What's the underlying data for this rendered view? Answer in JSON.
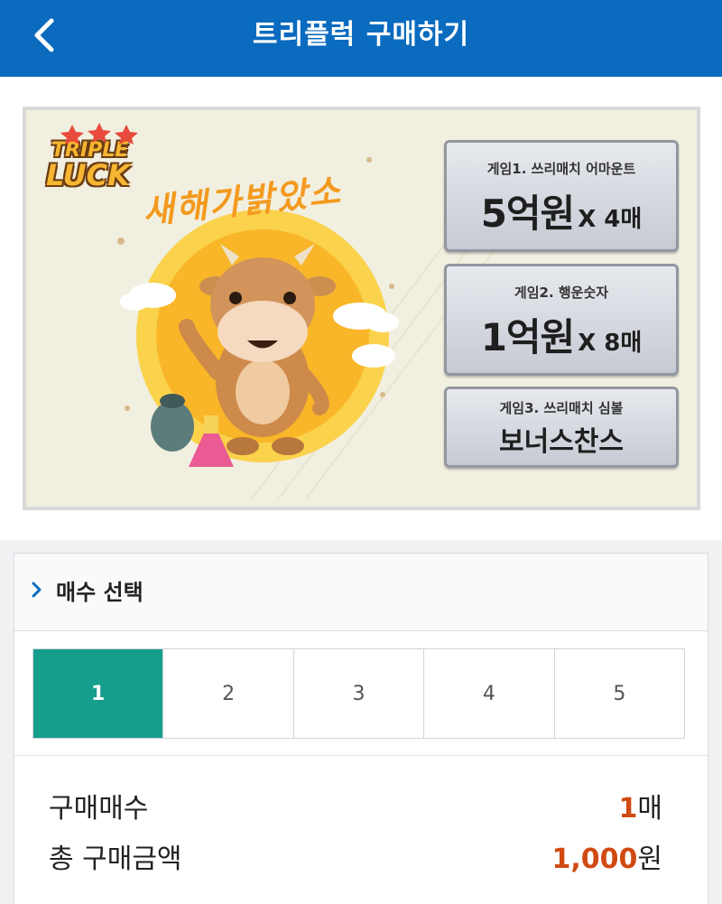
{
  "header": {
    "title": "트리플럭 구매하기",
    "back_icon": "chevron-left-icon"
  },
  "banner": {
    "logo_line1": "TRIPLE",
    "logo_line2": "LUCK",
    "slogan": "새해가밝았소",
    "games": [
      {
        "label": "게임1. 쓰리매치 어마운트",
        "amount": "5억원",
        "count": "X 4매"
      },
      {
        "label": "게임2. 행운숫자",
        "amount": "1억원",
        "count": "X 8매"
      },
      {
        "label": "게임3. 쓰리매치 심볼",
        "amount": "보너스찬스"
      }
    ]
  },
  "quantity_section": {
    "title": "매수 선택",
    "options": [
      "1",
      "2",
      "3",
      "4",
      "5"
    ],
    "selected": "1"
  },
  "summary": {
    "count_label": "구매매수",
    "count_value": "1",
    "count_unit": "매",
    "total_label": "총 구매금액",
    "total_value": "1,000",
    "total_unit": "원"
  },
  "colors": {
    "header_bg": "#0a6bbf",
    "selected_bg": "#169e8c",
    "accent_number": "#d04a12"
  }
}
